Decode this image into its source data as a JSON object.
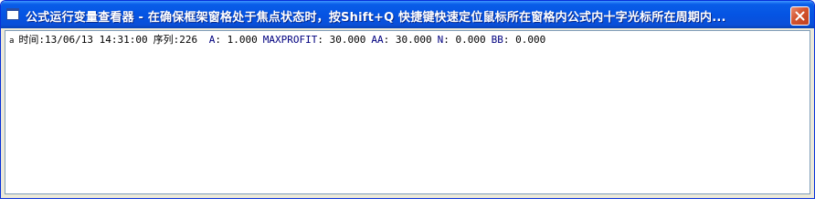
{
  "window": {
    "title": "公式运行变量查看器 - 在确保框架窗格处于焦点状态时，按Shift+Q 快捷键快速定位鼠标所在窗格内公式内十字光标所在周期内...",
    "close_label": "×"
  },
  "record": {
    "marker": "a",
    "time_label": "时间:",
    "time_value": "13/06/13 14:31:00",
    "seq_label": "序列:",
    "seq_value": "226",
    "vars": [
      {
        "name": "A",
        "value": "1.000"
      },
      {
        "name": "MAXPROFIT",
        "value": "30.000"
      },
      {
        "name": "AA",
        "value": "30.000"
      },
      {
        "name": "N",
        "value": "0.000"
      },
      {
        "name": "BB",
        "value": "0.000"
      }
    ]
  },
  "colors": {
    "titlebar": "#0554e3",
    "var_name": "#00007f",
    "close": "#d3532e"
  }
}
